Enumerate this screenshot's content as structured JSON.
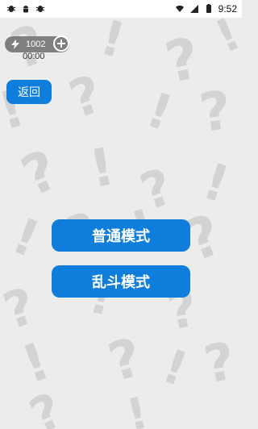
{
  "status_bar": {
    "time": "9:52",
    "left_icons": [
      "insect-icon",
      "android-icon",
      "insect-icon"
    ],
    "right_icons": [
      "wifi-icon",
      "signal-icon",
      "battery-icon"
    ]
  },
  "hud": {
    "coins": "1002",
    "timer": "00:00"
  },
  "buttons": {
    "back": "返回",
    "normal_mode": "普通模式",
    "brawl_mode": "乱斗模式"
  },
  "colors": {
    "accent": "#0f7ddb",
    "background": "#ececec"
  }
}
